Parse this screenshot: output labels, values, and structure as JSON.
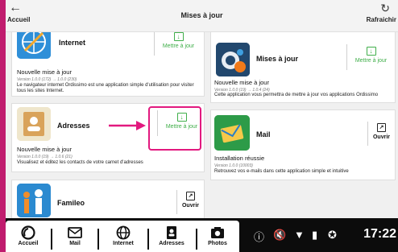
{
  "topbar": {
    "back_label": "Accueil",
    "title": "Mises à jour",
    "refresh_label": "Rafraichir"
  },
  "cards": {
    "internet": {
      "name": "Internet",
      "status": "Nouvelle mise à jour",
      "version": "Version 1.0.0 (172) → 1.0.0 (230)",
      "desc": "Le navigateur internet Ordissimo est une application simple d'utilisation pour visiter tous les sites Internet.",
      "action": "Mettre à jour"
    },
    "updates": {
      "name": "Mises à jour",
      "status": "Nouvelle mise à jour",
      "version": "Version 1.0.0 (19) → 1.0.4 (24)",
      "desc": "Cette application vous permettra de mettre à jour vos applications Ordissimo",
      "action": "Mettre à jour"
    },
    "adresses": {
      "name": "Adresses",
      "status": "Nouvelle mise à jour",
      "version": "Version 1.0.0 (19) → 1.0.6 (21)",
      "desc": "Visualisez et éditez les contacts de votre carnet d'adresses",
      "action": "Mettre à jour"
    },
    "mail": {
      "name": "Mail",
      "status": "Installation réussie",
      "version": "Version 1.0.0 (10003)",
      "desc": "Retrouvez vos e-mails dans cette application simple et intuitive",
      "action": "Ouvrir"
    },
    "fameleo": {
      "name": "Famileo",
      "action": "Ouvrir"
    }
  },
  "nav": {
    "items": [
      "Accueil",
      "Mail",
      "Internet",
      "Adresses",
      "Photos"
    ]
  },
  "status_bar": {
    "time": "17:22"
  },
  "colors": {
    "accent_green": "#3fae49",
    "highlight_magenta": "#e2197f",
    "edge_strip": "#c01c6e"
  }
}
